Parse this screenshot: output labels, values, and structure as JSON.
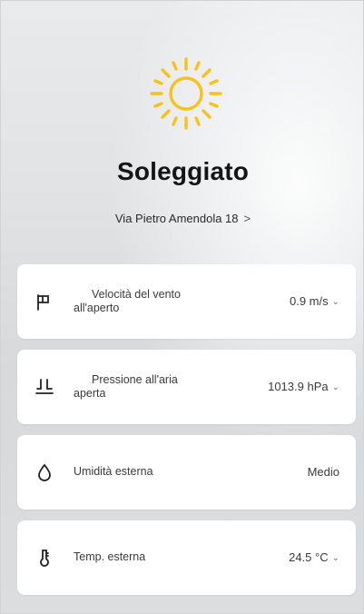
{
  "weather": {
    "icon": "sun-icon",
    "condition": "Soleggiato",
    "location": "Via Pietro Amendola 18",
    "location_chevron": ">",
    "sun_color": "#f7c21a"
  },
  "cards": [
    {
      "icon": "wind-icon",
      "label_line1": "Velocità del vento",
      "label_line2": "all'aperto",
      "value": "0.9 m/s",
      "has_dropdown": true
    },
    {
      "icon": "pressure-icon",
      "label_line1": "Pressione all'aria",
      "label_line2": "aperta",
      "value": "1013.9 hPa",
      "has_dropdown": true
    },
    {
      "icon": "humidity-icon",
      "label": "Umidità esterna",
      "value": "Medio",
      "has_dropdown": false
    },
    {
      "icon": "thermometer-icon",
      "label": "Temp. esterna",
      "value": "24.5 °C",
      "has_dropdown": true
    }
  ],
  "dropdown_chevron": "⌄"
}
